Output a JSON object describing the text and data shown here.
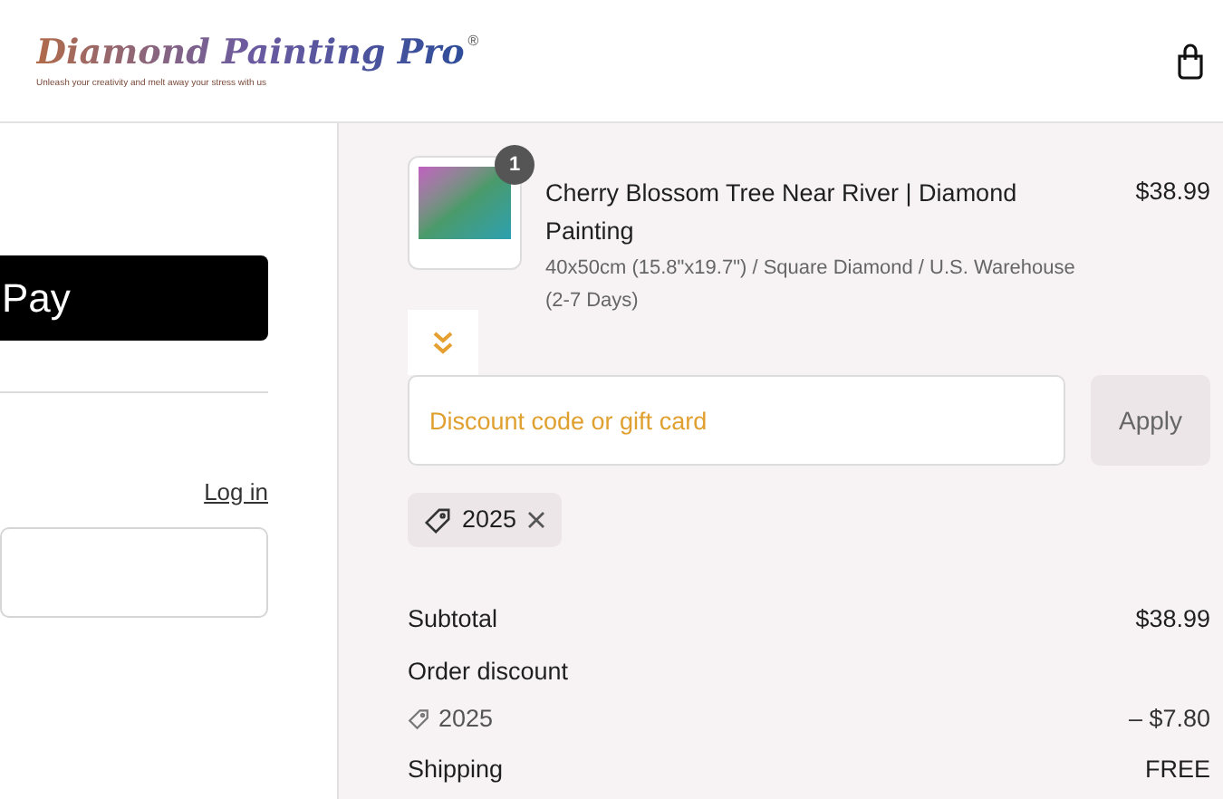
{
  "header": {
    "logo": {
      "brand": "Diamond Painting Pro",
      "mark": "®",
      "tagline": "Unleash your creativity and melt away your stress with us"
    }
  },
  "checkout": {
    "express_button": "Pay",
    "login_link": "Log in"
  },
  "order_summary": {
    "items": [
      {
        "quantity": "1",
        "title": "Cherry Blossom Tree Near River | Diamond Painting",
        "variant": "40x50cm (15.8\"x19.7\") / Square Diamond / U.S. Warehouse (2-7 Days)",
        "price": "$38.99"
      }
    ],
    "discount_field": {
      "placeholder": "Discount code or gift card"
    },
    "apply_button": "Apply",
    "applied_codes": [
      "2025"
    ],
    "subtotal": {
      "label": "Subtotal",
      "value": "$38.99"
    },
    "order_discount": {
      "label": "Order discount",
      "code": "2025",
      "value": "– $7.80"
    },
    "shipping": {
      "label": "Shipping",
      "value": "FREE"
    }
  }
}
